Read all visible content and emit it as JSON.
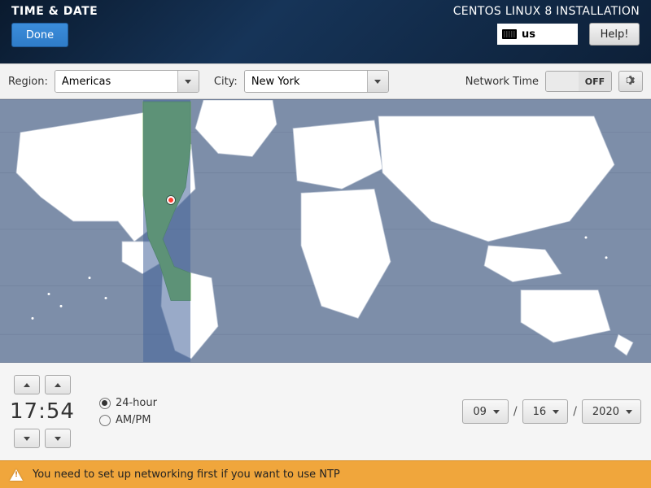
{
  "header": {
    "title": "TIME & DATE",
    "done_label": "Done",
    "install_title": "CENTOS LINUX 8 INSTALLATION",
    "keyboard_layout": "us",
    "help_label": "Help!"
  },
  "selectors": {
    "region_label": "Region:",
    "region_value": "Americas",
    "city_label": "City:",
    "city_value": "New York",
    "network_time_label": "Network Time",
    "network_time_state": "OFF"
  },
  "map": {
    "selected_city": "New York",
    "marker_icon": "location-pin"
  },
  "time": {
    "display": "17:54",
    "format_24h_label": "24-hour",
    "format_ampm_label": "AM/PM",
    "format_selected": "24-hour"
  },
  "date": {
    "month": "09",
    "day": "16",
    "year": "2020",
    "separator": "/"
  },
  "warning": {
    "message": "You need to set up networking first if you want to use NTP"
  }
}
